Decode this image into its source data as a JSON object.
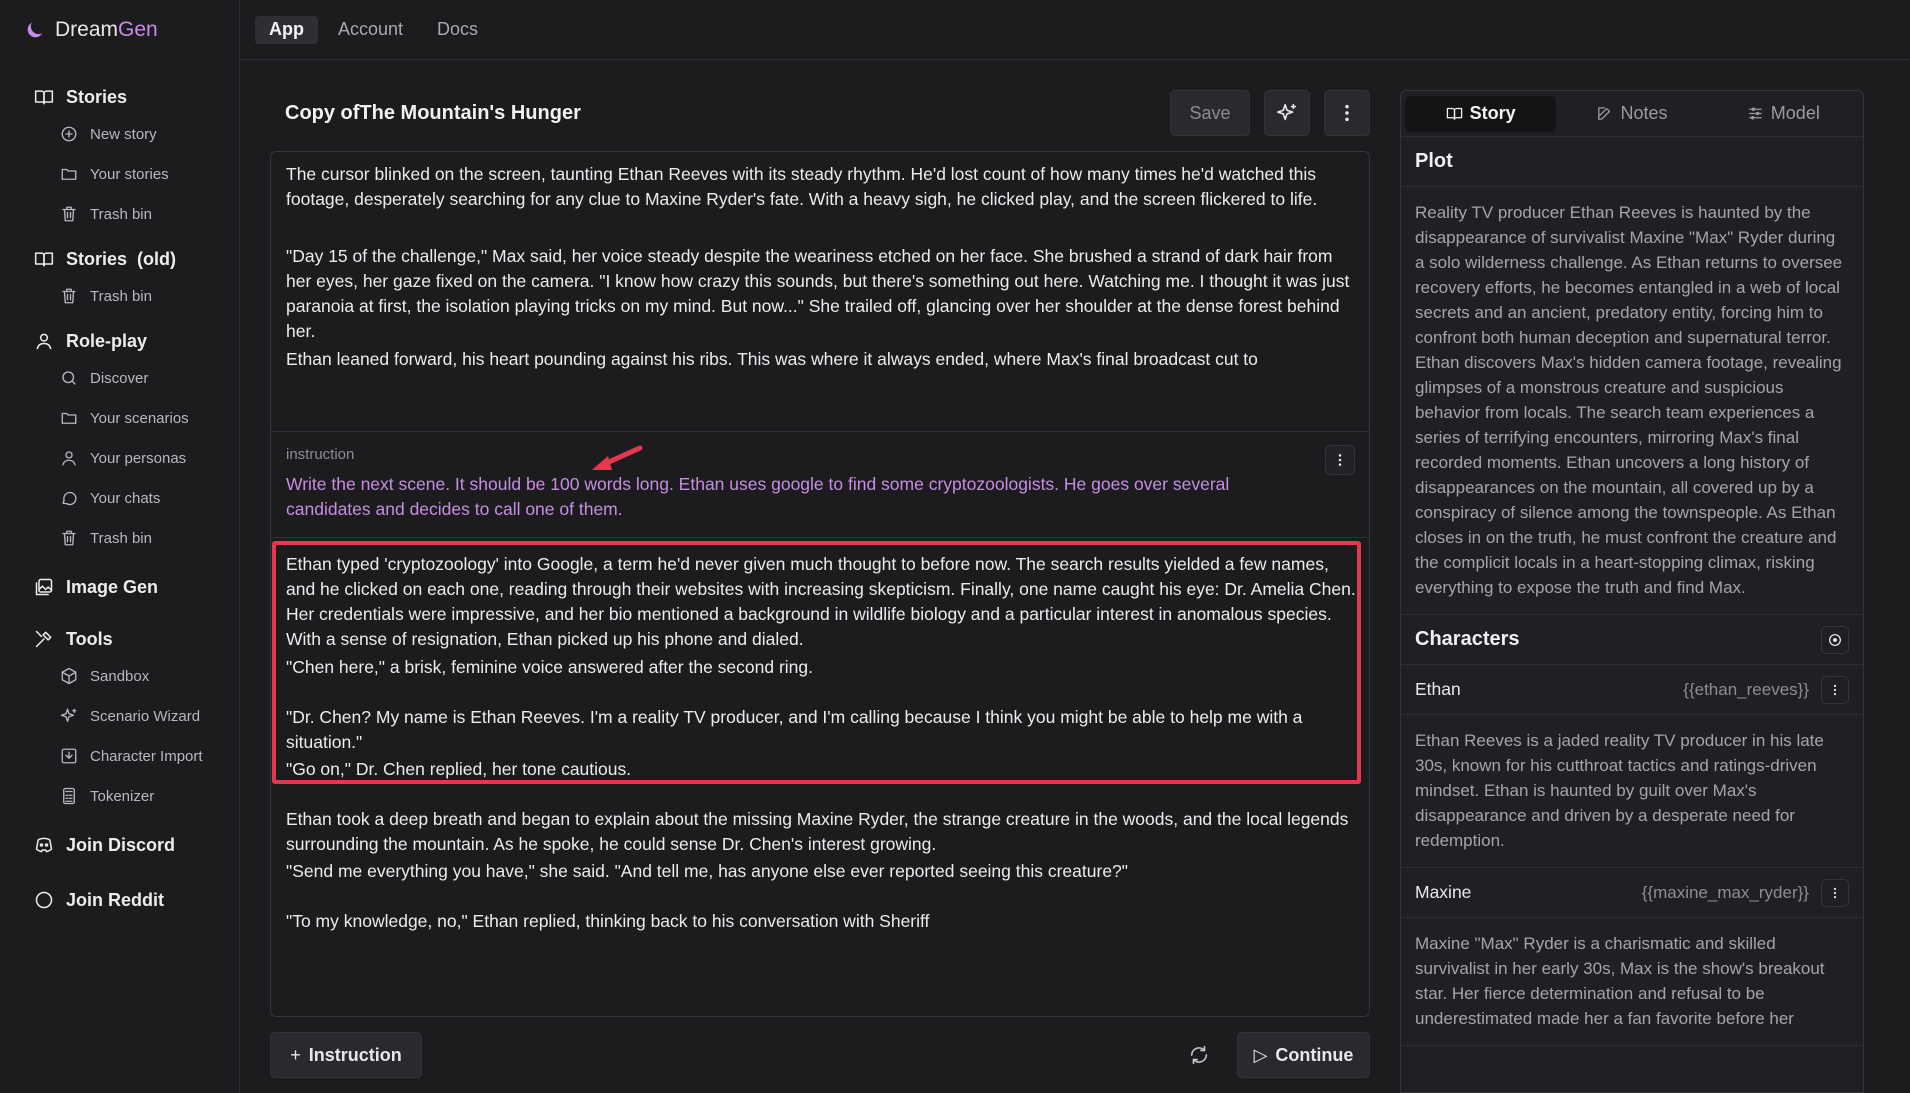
{
  "brand": {
    "part1": "Dream",
    "part2": "Gen"
  },
  "topnav": [
    {
      "label": "App",
      "active": true
    },
    {
      "label": "Account",
      "active": false
    },
    {
      "label": "Docs",
      "active": false
    }
  ],
  "sidebar": {
    "stories": {
      "label": "Stories",
      "items": [
        "New story",
        "Your stories",
        "Trash bin"
      ]
    },
    "stories_old": {
      "label": "Stories  (old)",
      "items": [
        "Trash bin"
      ]
    },
    "roleplay": {
      "label": "Role-play",
      "items": [
        "Discover",
        "Your scenarios",
        "Your personas",
        "Your chats",
        "Trash bin"
      ]
    },
    "image_gen": {
      "label": "Image Gen"
    },
    "tools": {
      "label": "Tools",
      "items": [
        "Sandbox",
        "Scenario Wizard",
        "Character Import",
        "Tokenizer"
      ]
    },
    "discord": {
      "label": "Join Discord"
    },
    "reddit": {
      "label": "Join Reddit"
    }
  },
  "editor": {
    "title": "Copy ofThe Mountain's Hunger",
    "save_label": "Save",
    "paragraphs_top": [
      "The cursor blinked on the screen, taunting Ethan Reeves with its steady rhythm. He'd lost count of how many times he'd watched this footage, desperately searching for any clue to Maxine Ryder's fate. With a heavy sigh, he clicked play, and the screen flickered to life.",
      "\"Day 15 of the challenge,\" Max said, her voice steady despite the weariness etched on her face. She brushed a strand of dark hair from her eyes, her gaze fixed on the camera. \"I know how crazy this sounds, but there's something out here. Watching me. I thought it was just paranoia at first, the isolation playing tricks on my mind. But now...\" She trailed off, glancing over her shoulder at the dense forest behind her.",
      "Ethan leaned forward, his heart pounding against his ribs. This was where it always ended, where Max's final broadcast cut to"
    ],
    "instruction": {
      "label": "instruction",
      "text": "Write the next scene. It should be 100 words long. Ethan uses google to find some cryptozoologists. He goes over several candidates and decides to call one of them."
    },
    "paragraphs_generated": [
      "Ethan typed 'cryptozoology' into Google, a term he'd never given much thought to before now. The search results yielded a few names, and he clicked on each one, reading through their websites with increasing skepticism. Finally, one name caught his eye: Dr. Amelia Chen. Her credentials were impressive, and her bio mentioned a background in wildlife biology and a particular interest in anomalous species. With a sense of resignation, Ethan picked up his phone and dialed.",
      "\"Chen here,\" a brisk, feminine voice answered after the second ring.",
      "\"Dr. Chen? My name is Ethan Reeves. I'm a reality TV producer, and I'm calling because I think you might be able to help me with a situation.\"",
      "\"Go on,\" Dr. Chen replied, her tone cautious.",
      "Ethan took a deep breath and began to explain about the missing Maxine Ryder, the strange creature in the woods, and the local legends surrounding the mountain. As he spoke, he could sense Dr. Chen's interest growing.",
      "\"Send me everything you have,\" she said. \"And tell me, has anyone else ever reported seeing this creature?\"",
      "\"To my knowledge, no,\" Ethan replied, thinking back to his conversation with Sheriff"
    ],
    "instruction_button": "Instruction",
    "continue_button": "Continue"
  },
  "panel": {
    "tabs": [
      {
        "label": "Story",
        "icon": "book-icon",
        "active": true
      },
      {
        "label": "Notes",
        "icon": "edit-icon",
        "active": false
      },
      {
        "label": "Model",
        "icon": "sliders-icon",
        "active": false
      }
    ],
    "plot_heading": "Plot",
    "plot_text": "Reality TV producer Ethan Reeves is haunted by the disappearance of survivalist Maxine \"Max\" Ryder during a solo wilderness challenge. As Ethan returns to oversee recovery efforts, he becomes entangled in a web of local secrets and an ancient, predatory entity, forcing him to confront both human deception and supernatural terror. Ethan discovers Max's hidden camera footage, revealing glimpses of a monstrous creature and suspicious behavior from locals. The search team experiences a series of terrifying encounters, mirroring Max's final recorded moments. Ethan uncovers a long history of disappearances on the mountain, all covered up by a conspiracy of silence among the townspeople. As Ethan closes in on the truth, he must confront the creature and the complicit locals in a heart-stopping climax, risking everything to expose the truth and find Max.",
    "characters_heading": "Characters",
    "characters": [
      {
        "name": "Ethan",
        "tag": "{{ethan_reeves}}",
        "description": "Ethan Reeves is a jaded reality TV producer in his late 30s, known for his cutthroat tactics and ratings-driven mindset. Ethan is haunted by guilt over Max's disappearance and driven by a desperate need for redemption."
      },
      {
        "name": "Maxine",
        "tag": "{{maxine_max_ryder}}",
        "description": "Maxine \"Max\" Ryder is a charismatic and skilled survivalist in her early 30s, Max is the show's breakout star. Her fierce determination and refusal to be underestimated made her a fan favorite before her"
      }
    ]
  },
  "colors": {
    "accent_purple": "#c98be8",
    "instruction_text": "#c68ee0",
    "highlight_red": "#e5384f"
  }
}
